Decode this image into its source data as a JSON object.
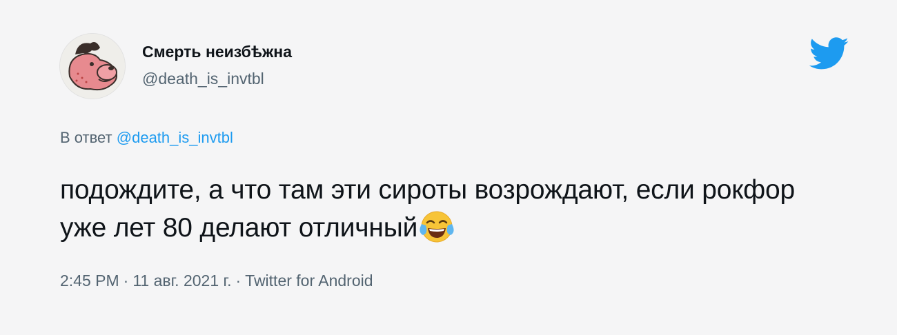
{
  "author": {
    "display_name": "Смерть неизбѣжна",
    "handle": "@death_is_invtbl",
    "avatar_icon": "cartoon-bulldog-avatar"
  },
  "brand": {
    "logo_icon": "twitter-bird-icon",
    "color": "#1d9bf0"
  },
  "reply": {
    "prefix": "В ответ",
    "mention": "@death_is_invtbl"
  },
  "tweet": {
    "text": "подождите, а что там эти сироты возрождают, если рокфор уже лет 80 делают отличный",
    "emoji": "face-with-tears-of-joy-icon"
  },
  "meta": {
    "time": "2:45 PM",
    "date": "11 авг. 2021 г.",
    "source": "Twitter for Android",
    "separator": "·"
  }
}
